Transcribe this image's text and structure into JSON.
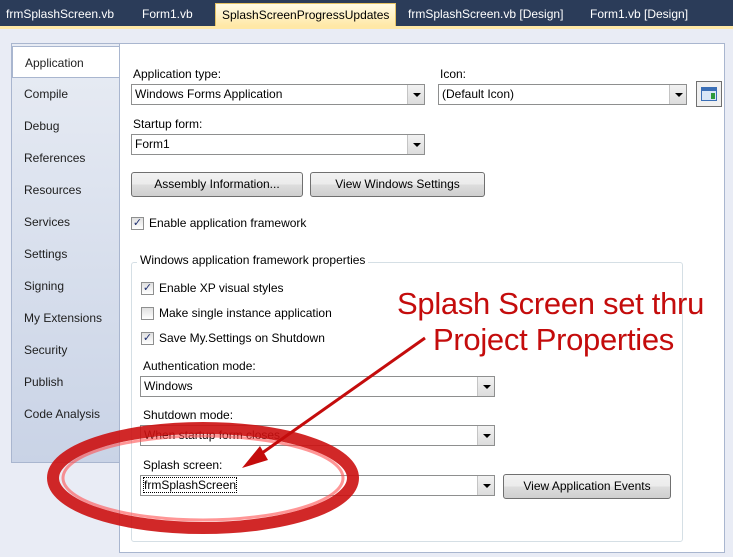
{
  "doc_tabs": [
    {
      "label": "frmSplashScreen.vb",
      "active": false
    },
    {
      "label": "Form1.vb",
      "active": false
    },
    {
      "label": "SplashScreenProgressUpdates",
      "active": true
    },
    {
      "label": "frmSplashScreen.vb [Design]",
      "active": false
    },
    {
      "label": "Form1.vb [Design]",
      "active": false
    }
  ],
  "nav": {
    "items": [
      "Application",
      "Compile",
      "Debug",
      "References",
      "Resources",
      "Services",
      "Settings",
      "Signing",
      "My Extensions",
      "Security",
      "Publish",
      "Code Analysis"
    ],
    "selected": "Application"
  },
  "app": {
    "app_type_label": "Application type:",
    "app_type_value": "Windows Forms Application",
    "icon_label": "Icon:",
    "icon_value": "(Default Icon)",
    "startup_label": "Startup form:",
    "startup_value": "Form1",
    "assembly_button": "Assembly Information...",
    "view_settings_button": "View Windows Settings",
    "enable_framework_label": "Enable application framework",
    "enable_framework_checked": true
  },
  "framework": {
    "title": "Windows application framework properties",
    "xp_styles_label": "Enable XP visual styles",
    "xp_styles_checked": true,
    "single_instance_label": "Make single instance application",
    "single_instance_checked": false,
    "save_settings_label": "Save My.Settings on Shutdown",
    "save_settings_checked": true,
    "auth_label": "Authentication mode:",
    "auth_value": "Windows",
    "shutdown_label": "Shutdown mode:",
    "shutdown_value": "When startup form closes",
    "splash_label": "Splash screen:",
    "splash_value": "frmSplashScreen",
    "view_events_button": "View Application Events"
  },
  "annotation": {
    "line1": "Splash Screen set thru",
    "line2": "Project Properties",
    "color": "#c40c0c"
  },
  "colors": {
    "tab_strip": "#2b3c59",
    "active_tab": "#ffe8a6",
    "nav_bg": "#c9d3e6",
    "annotation_red": "#c40c0c"
  }
}
